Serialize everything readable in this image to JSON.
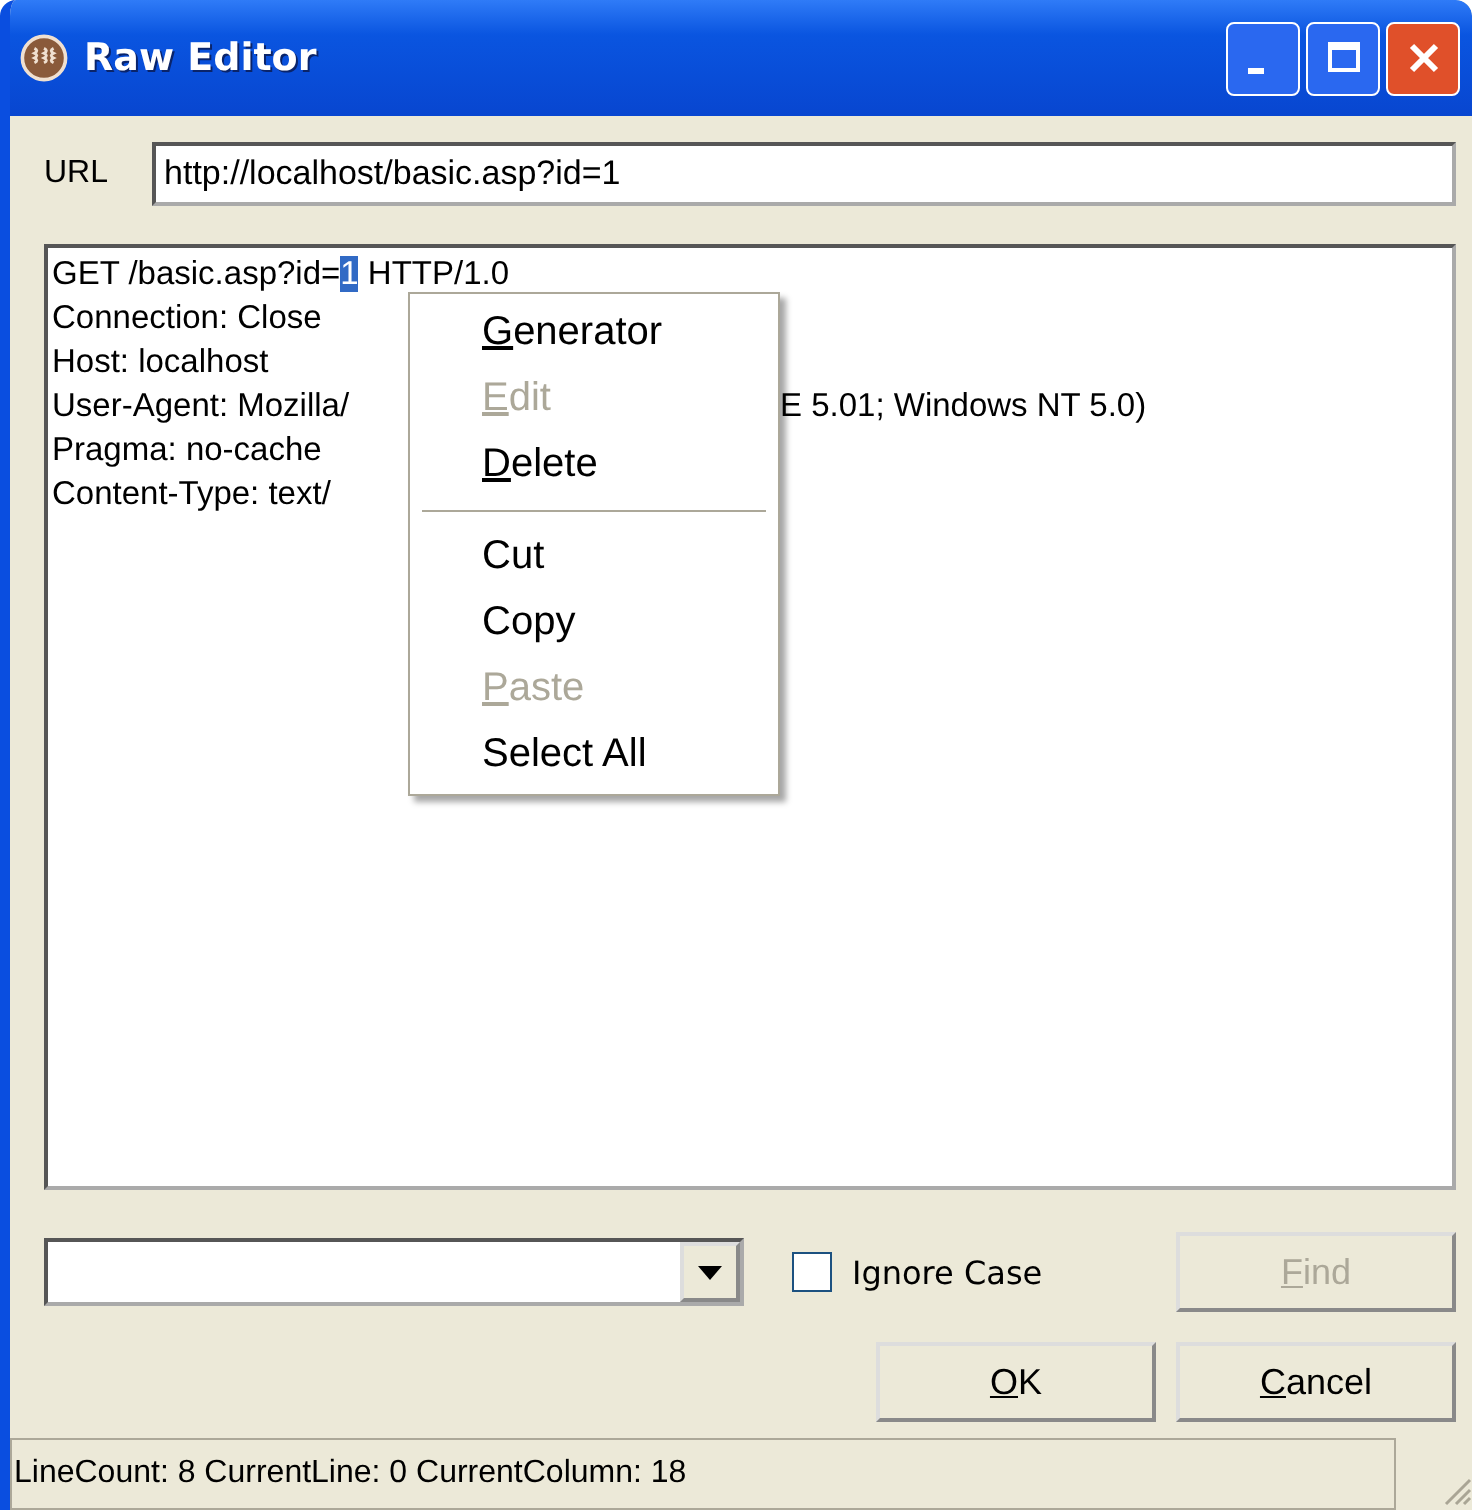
{
  "window": {
    "title": "Raw Editor"
  },
  "url": {
    "label": "URL",
    "value": "http://localhost/basic.asp?id=1"
  },
  "editor": {
    "lines": [
      {
        "left": "GET /basic.asp?id=",
        "selection": "1",
        "after": " HTTP/1.0"
      },
      {
        "left": "Connection: Close"
      },
      {
        "left": "Host: localhost"
      },
      {
        "left": "User-Agent: Mozilla/",
        "right": "E 5.01; Windows NT 5.0)"
      },
      {
        "left": "Pragma: no-cache"
      },
      {
        "left": "Content-Type: text/"
      }
    ]
  },
  "context_menu": [
    {
      "kind": "item",
      "label": "Generator",
      "mnemonic": true,
      "disabled": false
    },
    {
      "kind": "item",
      "label": "Edit",
      "mnemonic": true,
      "disabled": true
    },
    {
      "kind": "item",
      "label": "Delete",
      "mnemonic": true,
      "disabled": false
    },
    {
      "kind": "separator"
    },
    {
      "kind": "item",
      "label": "Cut",
      "mnemonic": false,
      "disabled": false
    },
    {
      "kind": "item",
      "label": "Copy",
      "mnemonic": false,
      "disabled": false
    },
    {
      "kind": "item",
      "label": "Paste",
      "mnemonic": true,
      "disabled": true
    },
    {
      "kind": "item",
      "label": "Select All",
      "mnemonic": false,
      "disabled": false
    }
  ],
  "find": {
    "ignore_case": {
      "label": "Ignore Case",
      "checked": false
    },
    "button": {
      "label": "Find",
      "mnemonic": true,
      "disabled": true
    }
  },
  "buttons": [
    {
      "label": "OK",
      "mnemonic": true
    },
    {
      "label": "Cancel",
      "mnemonic": true
    }
  ],
  "status_bar": "LineCount: 8 CurrentLine: 0 CurrentColumn: 18"
}
